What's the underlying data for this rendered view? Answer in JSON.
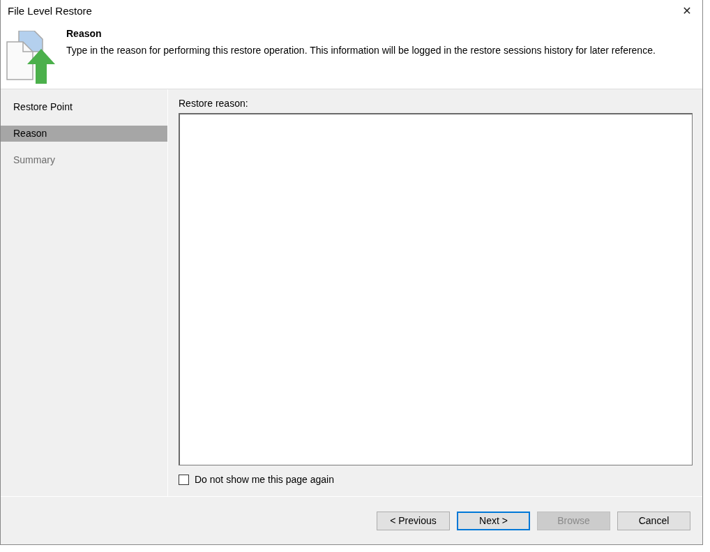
{
  "window": {
    "title": "File Level Restore",
    "close": "✕"
  },
  "header": {
    "title": "Reason",
    "description": "Type in the reason for performing this restore operation. This information will be logged in the restore sessions history for later reference."
  },
  "sidebar": {
    "items": [
      {
        "label": "Restore Point",
        "selected": false,
        "disabled": false
      },
      {
        "label": "Reason",
        "selected": true,
        "disabled": false
      },
      {
        "label": "Summary",
        "selected": false,
        "disabled": true
      }
    ]
  },
  "form": {
    "label": "Restore reason:",
    "checkbox": {
      "label": "Do not show me this page again",
      "checked": false
    }
  },
  "buttons": [
    {
      "label": "< Previous",
      "disabled": false,
      "focused": false
    },
    {
      "label": "Next >",
      "disabled": false,
      "focused": true
    },
    {
      "label": "Browse",
      "disabled": true,
      "focused": false
    },
    {
      "label": "Cancel",
      "disabled": false,
      "focused": false
    }
  ]
}
